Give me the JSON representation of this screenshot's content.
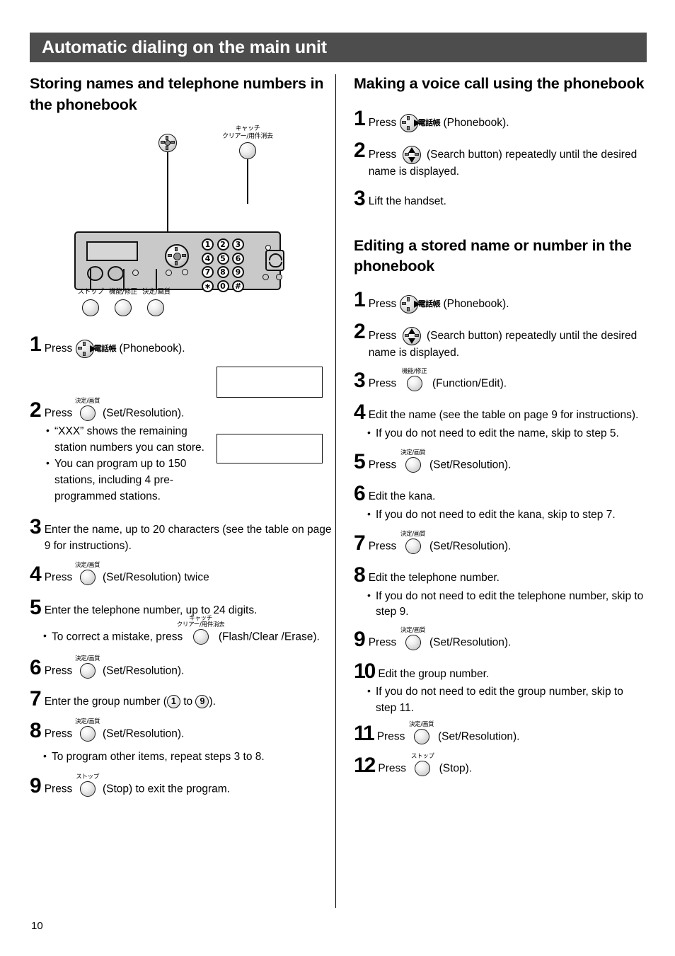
{
  "header": {
    "title": "Automatic dialing on the main unit",
    "bar_color": "#4d4d4d"
  },
  "page_number": "10",
  "device_illustration": {
    "callouts": [
      {
        "name": "catch-clear-erase",
        "line1": "キャッチ",
        "line2": "クリアー/用件消去"
      },
      {
        "name": "stop",
        "label": "ストップ"
      },
      {
        "name": "function-edit",
        "label": "機能/修正"
      },
      {
        "name": "set-resolution",
        "label": "決定/画質"
      }
    ],
    "keypad": [
      "1",
      "2",
      "3",
      "4",
      "5",
      "6",
      "7",
      "8",
      "9",
      "∗",
      "0",
      "#"
    ]
  },
  "left_column": {
    "heading": "Storing names and telephone numbers in the phonebook",
    "steps": [
      {
        "num": "1",
        "pre": "Press",
        "icon": "navpad-phonebook-icon",
        "kanji": "電話帳",
        "post": "(Phonebook)."
      },
      {
        "num": "2",
        "pre": "Press",
        "icon": "round-button-icon",
        "kana": "決定/画質",
        "post": "(Set/Resolution).",
        "bullets": [
          "“XXX” shows the remaining station numbers you can store.",
          "You can program up to 150 stations, including 4 pre-programmed stations."
        ]
      },
      {
        "num": "3",
        "text": "Enter the name, up to 20 characters (see the table on page 9 for instructions)."
      },
      {
        "num": "4",
        "pre": "Press",
        "icon": "round-button-icon",
        "kana": "決定/画質",
        "post": "(Set/Resolution) twice"
      },
      {
        "num": "5",
        "text": "Enter the telephone number, up to 24 digits.",
        "bullet_pre": "To correct a mistake, press",
        "bullet_kana1": "キャッチ",
        "bullet_kana2": "クリアー/用件消去",
        "bullet_post": "(Flash/Clear /Erase)."
      },
      {
        "num": "6",
        "pre": "Press",
        "icon": "round-button-icon",
        "kana": "決定/画質",
        "post": "(Set/Resolution)."
      },
      {
        "num": "7",
        "pre": "Enter the group number (",
        "digit_from": "1",
        "mid": "to",
        "digit_to": "9",
        "post": ")."
      },
      {
        "num": "8",
        "pre": "Press",
        "icon": "round-button-icon",
        "kana": "決定/画質",
        "post": "(Set/Resolution).",
        "bullets": [
          "To program other items, repeat steps 3 to 8."
        ]
      },
      {
        "num": "9",
        "pre": "Press",
        "icon": "round-button-icon",
        "kana": "ストップ",
        "post": "(Stop) to exit the program."
      }
    ]
  },
  "right_column": {
    "section1": {
      "heading": "Making a voice call using the phonebook",
      "steps": [
        {
          "num": "1",
          "pre": "Press",
          "icon": "navpad-phonebook-icon",
          "kanji": "電話帳",
          "post": "(Phonebook)."
        },
        {
          "num": "2",
          "pre": "Press",
          "icon": "navpad-search-icon",
          "post": "(Search button) repeatedly until the desired name is displayed."
        },
        {
          "num": "3",
          "text": "Lift the handset."
        }
      ]
    },
    "section2": {
      "heading": "Editing a stored name or number in the phonebook",
      "steps": [
        {
          "num": "1",
          "pre": "Press",
          "icon": "navpad-phonebook-icon",
          "kanji": "電話帳",
          "post": "(Phonebook)."
        },
        {
          "num": "2",
          "pre": "Press",
          "icon": "navpad-search-icon",
          "post": "(Search button) repeatedly until the desired name is displayed."
        },
        {
          "num": "3",
          "pre": "Press",
          "icon": "round-button-icon",
          "kana": "機能/修正",
          "post": "(Function/Edit)."
        },
        {
          "num": "4",
          "text": "Edit the name (see the table on page 9 for instructions).",
          "bullets": [
            "If you do not need to edit the name, skip to step 5."
          ]
        },
        {
          "num": "5",
          "pre": "Press",
          "icon": "round-button-icon",
          "kana": "決定/画質",
          "post": "(Set/Resolution)."
        },
        {
          "num": "6",
          "text": "Edit the kana.",
          "bullets": [
            "If you do not need to edit the kana, skip to step 7."
          ]
        },
        {
          "num": "7",
          "pre": "Press",
          "icon": "round-button-icon",
          "kana": "決定/画質",
          "post": "(Set/Resolution)."
        },
        {
          "num": "8",
          "text": "Edit the telephone number.",
          "bullets": [
            "If you do not need to edit the telephone number, skip to step 9."
          ]
        },
        {
          "num": "9",
          "pre": "Press",
          "icon": "round-button-icon",
          "kana": "決定/画質",
          "post": "(Set/Resolution)."
        },
        {
          "num": "10",
          "text": "Edit the group number.",
          "bullets": [
            "If you do not need to edit the group number, skip to step 11."
          ]
        },
        {
          "num": "11",
          "pre": "Press",
          "icon": "round-button-icon",
          "kana": "決定/画質",
          "post": "(Set/Resolution)."
        },
        {
          "num": "12",
          "pre": "Press",
          "icon": "round-button-icon",
          "kana": "ストップ",
          "post": "(Stop)."
        }
      ]
    }
  }
}
